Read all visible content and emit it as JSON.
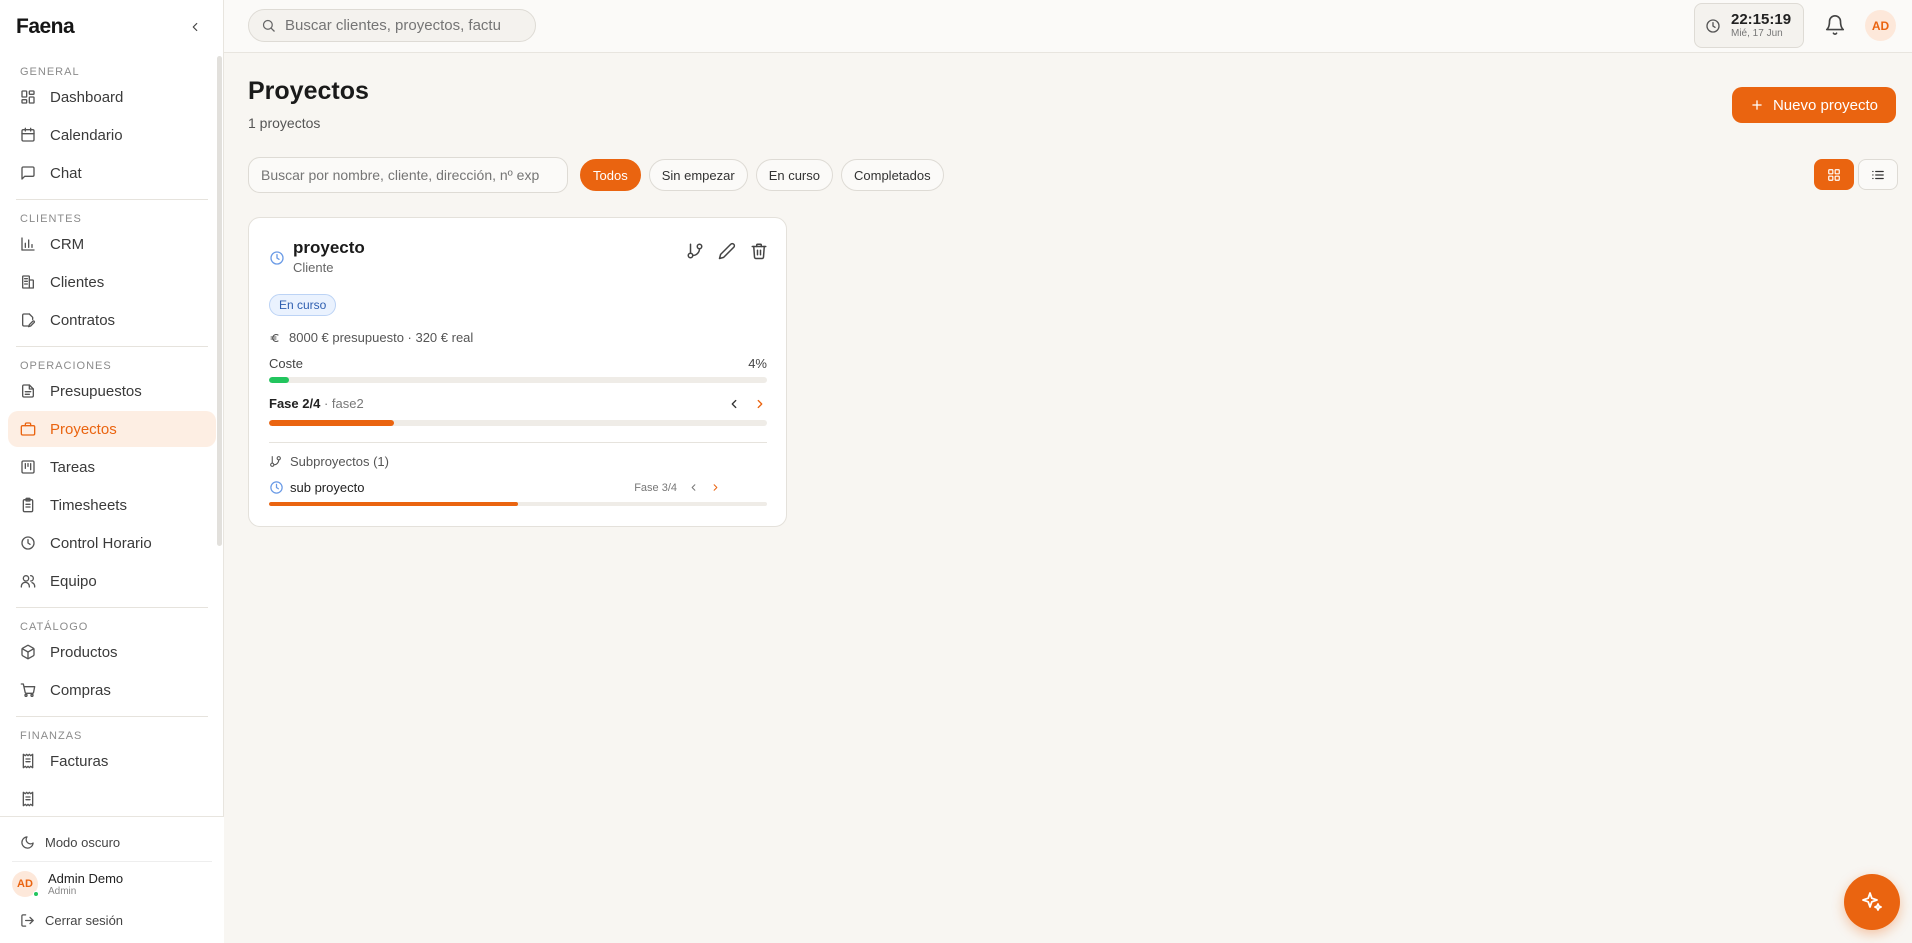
{
  "brand": "Faena",
  "sidebar": {
    "sections": [
      {
        "label": "GENERAL",
        "items": [
          {
            "label": "Dashboard",
            "icon": "dashboard-icon"
          },
          {
            "label": "Calendario",
            "icon": "calendar-icon"
          },
          {
            "label": "Chat",
            "icon": "chat-icon"
          }
        ]
      },
      {
        "label": "CLIENTES",
        "items": [
          {
            "label": "CRM",
            "icon": "bar-chart-icon"
          },
          {
            "label": "Clientes",
            "icon": "building-icon"
          },
          {
            "label": "Contratos",
            "icon": "contract-icon"
          }
        ]
      },
      {
        "label": "OPERACIONES",
        "items": [
          {
            "label": "Presupuestos",
            "icon": "document-icon"
          },
          {
            "label": "Proyectos",
            "icon": "briefcase-icon",
            "active": true
          },
          {
            "label": "Tareas",
            "icon": "kanban-icon"
          },
          {
            "label": "Timesheets",
            "icon": "clipboard-icon"
          },
          {
            "label": "Control Horario",
            "icon": "clock-icon"
          },
          {
            "label": "Equipo",
            "icon": "users-icon"
          }
        ]
      },
      {
        "label": "CATÁLOGO",
        "items": [
          {
            "label": "Productos",
            "icon": "package-icon"
          },
          {
            "label": "Compras",
            "icon": "cart-icon"
          }
        ]
      },
      {
        "label": "FINANZAS",
        "items": [
          {
            "label": "Facturas",
            "icon": "receipt-icon"
          },
          {
            "label": "",
            "icon": "receipt-icon"
          }
        ]
      }
    ],
    "dark_mode_label": "Modo oscuro",
    "user": {
      "initials": "AD",
      "name": "Admin Demo",
      "role": "Admin"
    },
    "logout_label": "Cerrar sesión"
  },
  "topbar": {
    "search_placeholder": "Buscar clientes, proyectos, factu",
    "time": "22:15:19",
    "date": "Mié, 17 Jun",
    "avatar_initials": "AD"
  },
  "page": {
    "title": "Proyectos",
    "subtitle": "1 proyectos",
    "new_button": "Nuevo proyecto",
    "search_placeholder": "Buscar por nombre, cliente, dirección, nº exp",
    "filters": [
      {
        "label": "Todos",
        "active": true
      },
      {
        "label": "Sin empezar",
        "active": false
      },
      {
        "label": "En curso",
        "active": false
      },
      {
        "label": "Completados",
        "active": false
      }
    ]
  },
  "project": {
    "name": "proyecto",
    "client": "Cliente",
    "status": "En curso",
    "budget_text": "8000 € presupuesto · 320 € real",
    "cost_label": "Coste",
    "cost_percent_label": "4%",
    "cost_fraction": 0.04,
    "phase_label": "Fase 2/4",
    "phase_name": "· fase2",
    "phase_fraction": 0.25,
    "subprojects_label": "Subproyectos (1)",
    "subprojects": [
      {
        "name": "sub proyecto",
        "phase_label": "Fase 3/4",
        "phase_fraction": 0.5
      }
    ]
  },
  "colors": {
    "accent": "#ea6410",
    "cost_bar": "#22c55e",
    "status_blue": "#2f5fb0"
  }
}
